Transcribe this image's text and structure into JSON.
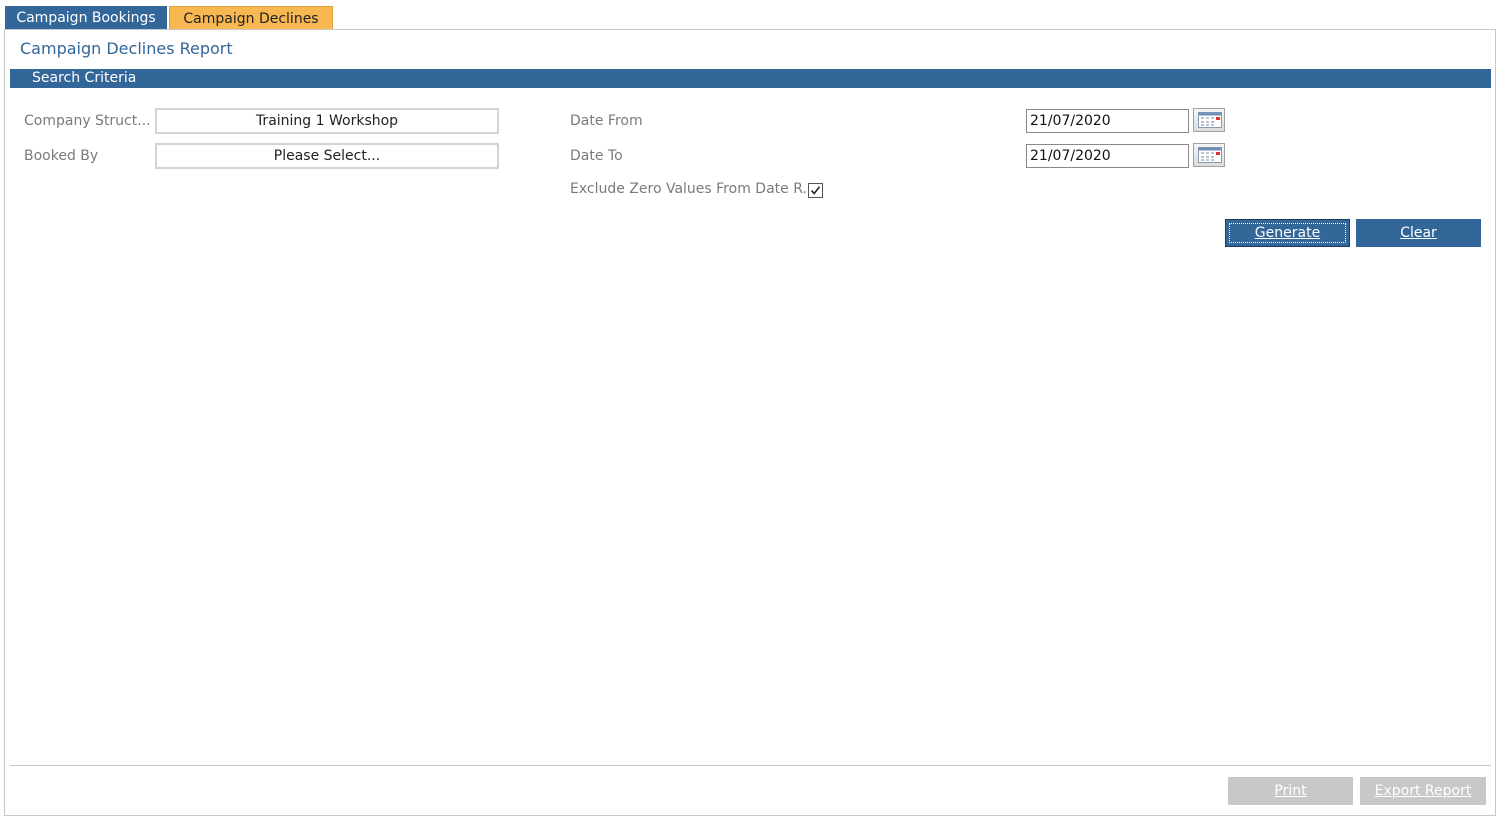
{
  "tabs": [
    {
      "label": "Campaign Bookings",
      "active": false
    },
    {
      "label": "Campaign Declines",
      "active": true
    }
  ],
  "report": {
    "title": "Campaign Declines Report",
    "criteria_header": "Search Criteria"
  },
  "form": {
    "company_structure": {
      "label": "Company Struct...",
      "value": "Training 1 Workshop"
    },
    "booked_by": {
      "label": "Booked By",
      "value": "Please Select..."
    },
    "date_from": {
      "label": "Date From",
      "value": "21/07/2020"
    },
    "date_to": {
      "label": "Date To",
      "value": "21/07/2020"
    },
    "exclude_zero": {
      "label": "Exclude Zero Values From Date R...",
      "checked": true
    }
  },
  "actions": {
    "generate_label": "Generate",
    "clear_label": "Clear",
    "print_label": "Print",
    "export_label": "Export Report"
  },
  "colors": {
    "primary": "#336699",
    "active_tab": "#f7b852",
    "disabled": "#c8c8c8"
  },
  "icons": {
    "calendar": "calendar-icon",
    "checkmark": "checkmark-icon"
  }
}
